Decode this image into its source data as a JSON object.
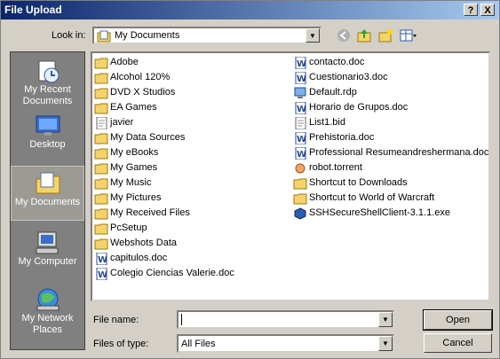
{
  "window": {
    "title": "File Upload"
  },
  "titlebar_buttons": {
    "help": "?",
    "close": "X"
  },
  "lookin": {
    "label": "Look in:",
    "value": "My Documents"
  },
  "places": [
    {
      "id": "recent",
      "label": "My Recent Documents",
      "icon": "recent-documents-icon"
    },
    {
      "id": "desktop",
      "label": "Desktop",
      "icon": "desktop-icon"
    },
    {
      "id": "mydocs",
      "label": "My Documents",
      "icon": "my-documents-icon",
      "active": true
    },
    {
      "id": "computer",
      "label": "My Computer",
      "icon": "my-computer-icon"
    },
    {
      "id": "network",
      "label": "My Network Places",
      "icon": "network-places-icon"
    }
  ],
  "files_col1": [
    {
      "name": "Adobe",
      "type": "folder"
    },
    {
      "name": "Alcohol 120%",
      "type": "folder"
    },
    {
      "name": "DVD X Studios",
      "type": "folder"
    },
    {
      "name": "EA Games",
      "type": "folder"
    },
    {
      "name": "javier",
      "type": "file"
    },
    {
      "name": "My Data Sources",
      "type": "folder"
    },
    {
      "name": "My eBooks",
      "type": "folder"
    },
    {
      "name": "My Games",
      "type": "folder"
    },
    {
      "name": "My Music",
      "type": "folder"
    },
    {
      "name": "My Pictures",
      "type": "folder"
    },
    {
      "name": "My Received Files",
      "type": "folder"
    },
    {
      "name": "PcSetup",
      "type": "folder"
    },
    {
      "name": "Webshots Data",
      "type": "folder"
    },
    {
      "name": "capitulos.doc",
      "type": "doc"
    },
    {
      "name": "Colegio Ciencias Valerie.doc",
      "type": "doc"
    }
  ],
  "files_col2": [
    {
      "name": "contacto.doc",
      "type": "doc"
    },
    {
      "name": "Cuestionario3.doc",
      "type": "doc"
    },
    {
      "name": "Default.rdp",
      "type": "rdp"
    },
    {
      "name": "Horario de Grupos.doc",
      "type": "doc"
    },
    {
      "name": "List1.bid",
      "type": "file"
    },
    {
      "name": "Prehistoria.doc",
      "type": "doc"
    },
    {
      "name": "Professional Resumeandreshermana.doc",
      "type": "doc"
    },
    {
      "name": "robot.torrent",
      "type": "torrent"
    },
    {
      "name": "Shortcut to Downloads",
      "type": "folder"
    },
    {
      "name": "Shortcut to World of Warcraft",
      "type": "folder"
    },
    {
      "name": "SSHSecureShellClient-3.1.1.exe",
      "type": "exe"
    }
  ],
  "filename": {
    "label": "File name:",
    "value": ""
  },
  "filetype": {
    "label": "Files of type:",
    "value": "All Files"
  },
  "buttons": {
    "open": "Open",
    "cancel": "Cancel"
  }
}
